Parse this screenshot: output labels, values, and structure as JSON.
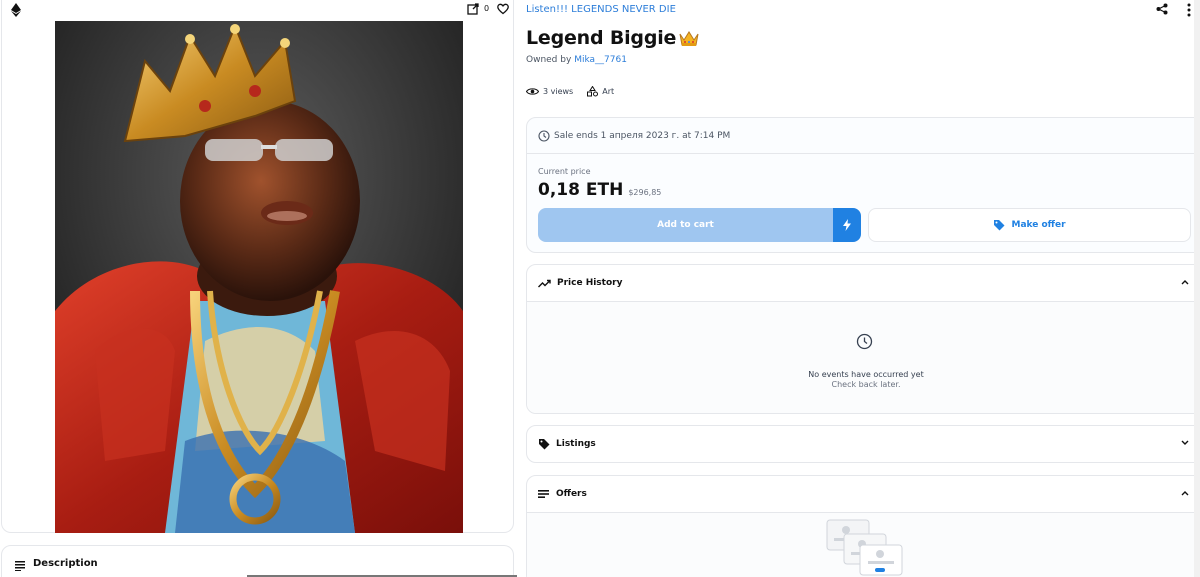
{
  "media": {
    "chain_icon": "ethereum-icon",
    "favorites_count": "0",
    "artwork_alt": "Legend Biggie artwork"
  },
  "description": {
    "label": "Description"
  },
  "item": {
    "collection": "Listen!!! LEGENDS NEVER DIE",
    "title": "Legend Biggie",
    "title_emoji": "crown-emoji",
    "owned_prefix": "Owned by",
    "owner": "Mika__7761",
    "views": "3 views",
    "category": "Art"
  },
  "sale": {
    "ends_text": "Sale ends 1 апреля 2023 г. at 7:14 PM",
    "current_price_label": "Current price",
    "price_eth": "0,18 ETH",
    "price_usd": "$296,85",
    "add_to_cart_label": "Add to cart",
    "make_offer_label": "Make offer"
  },
  "price_history": {
    "title": "Price History",
    "empty_title": "No events have occurred yet",
    "empty_sub": "Check back later."
  },
  "listings": {
    "title": "Listings"
  },
  "offers": {
    "title": "Offers"
  },
  "colors": {
    "accent": "#2081e2",
    "accent_light": "#9fc6f0",
    "link": "#2d7ed9",
    "border": "#e5e7eb"
  }
}
